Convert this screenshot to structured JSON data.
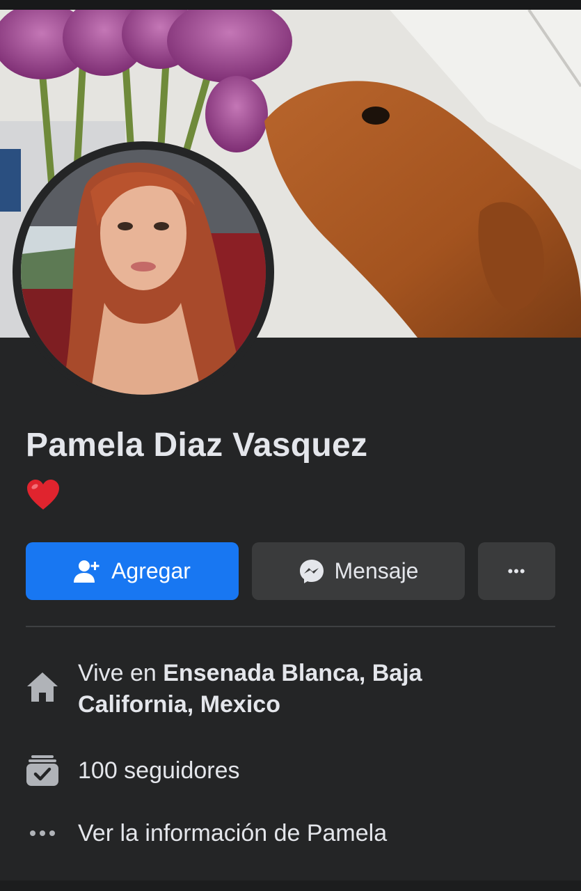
{
  "profile": {
    "name": "Pamela Diaz Vasquez",
    "bio_emoji": "❤️"
  },
  "actions": {
    "add_label": "Agregar",
    "message_label": "Mensaje",
    "more_label": "•••"
  },
  "details": {
    "lives_prefix": "Vive en ",
    "lives_place": "Ensenada Blanca, Baja California, Mexico",
    "followers": "100 seguidores",
    "see_info": "Ver la información de Pamela"
  },
  "colors": {
    "background": "#242526",
    "primary_button": "#1877f2",
    "secondary_button": "#3a3b3c",
    "text": "#e4e6eb",
    "icon": "#b0b3b8"
  },
  "icons": [
    "add-friend-icon",
    "messenger-icon",
    "more-icon",
    "home-icon",
    "followers-icon",
    "dots-icon"
  ]
}
